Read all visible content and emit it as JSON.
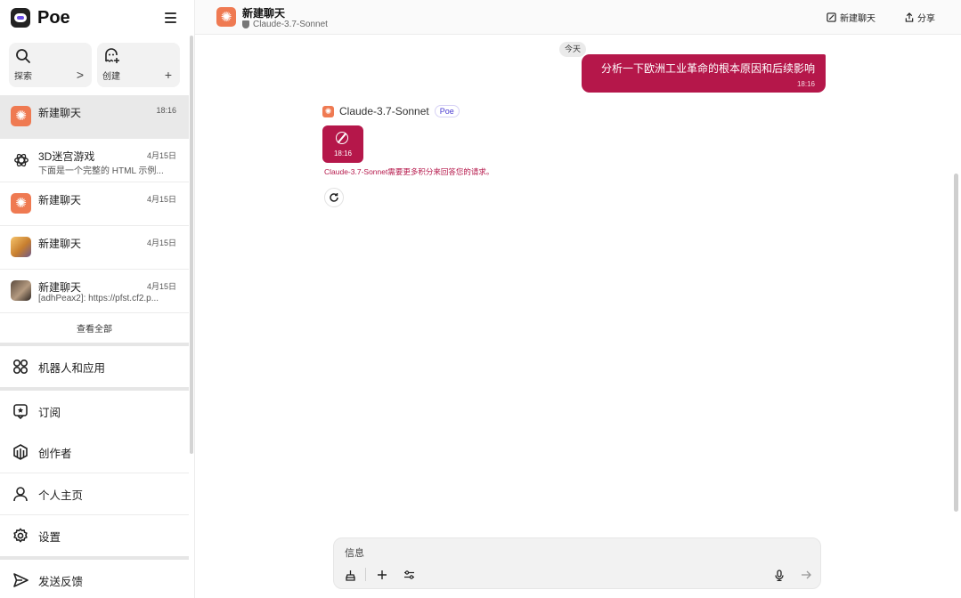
{
  "app": {
    "name": "Poe"
  },
  "quick": {
    "search_label": "探索",
    "search_arrow": ">",
    "create_label": "创建",
    "create_plus": "+"
  },
  "chats": [
    {
      "title": "新建聊天",
      "subtitle": "",
      "time": "18:16",
      "avatar": "claude-icon"
    },
    {
      "title": "3D迷宫游戏",
      "subtitle": "下面是一个完整的 HTML 示例...",
      "time": "4月15日",
      "avatar": "chatgpt-icon"
    },
    {
      "title": "新建聊天",
      "subtitle": "",
      "time": "4月15日",
      "avatar": "claude-icon"
    },
    {
      "title": "新建聊天",
      "subtitle": "",
      "time": "4月15日",
      "avatar": "bot-picture-icon"
    },
    {
      "title": "新建聊天",
      "subtitle": "[adhPeax2]: https://pfst.cf2.p...",
      "time": "4月15日",
      "avatar": "bot-picture-icon"
    }
  ],
  "see_all": "查看全部",
  "menu": {
    "bots": "机器人和应用",
    "subscribe": "订阅",
    "creators": "创作者",
    "profile": "个人主页",
    "settings": "设置",
    "feedback": "发送反馈"
  },
  "header": {
    "title": "新建聊天",
    "bot_name": "Claude-3.7-Sonnet",
    "new_chat": "新建聊天",
    "share": "分享"
  },
  "conversation": {
    "date": "今天",
    "user_message": "分析一下欧洲工业革命的根本原因和后续影响",
    "user_time": "18:16",
    "bot_name": "Claude-3.7-Sonnet",
    "bot_badge": "Poe",
    "bot_time": "18:16",
    "error_text": "Claude-3.7-Sonnet需要更多积分来回答您的请求。"
  },
  "composer": {
    "placeholder": "信息"
  },
  "colors": {
    "accent": "#b5174a",
    "claude": "#ef7a52",
    "badge": "#4a3bd1"
  }
}
